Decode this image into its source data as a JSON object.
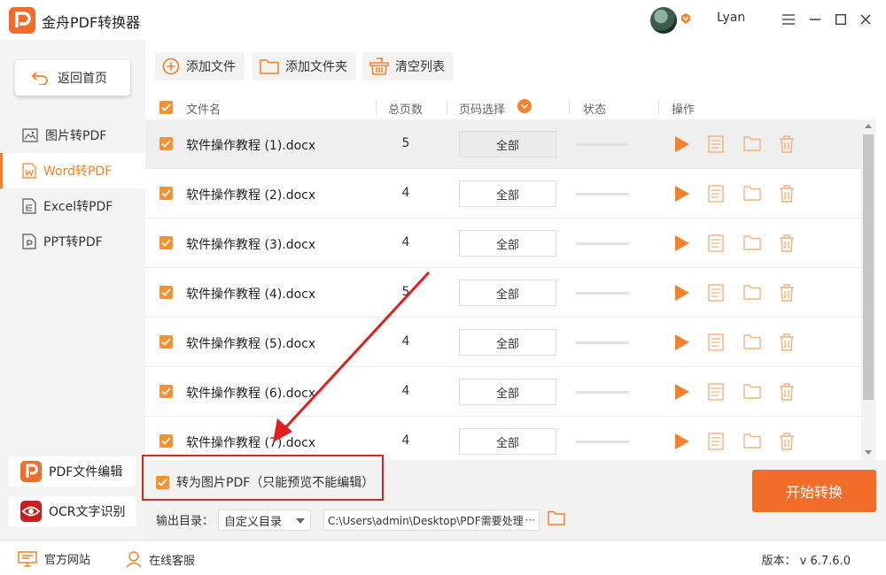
{
  "app": {
    "title": "金舟PDF转换器",
    "username": "Lyan"
  },
  "sidebar": {
    "back_label": "返回首页",
    "items": [
      {
        "label": "图片转PDF",
        "icon": "image-icon"
      },
      {
        "label": "Word转PDF",
        "icon": "word-icon",
        "active": true
      },
      {
        "label": "Excel转PDF",
        "icon": "excel-icon"
      },
      {
        "label": "PPT转PDF",
        "icon": "ppt-icon"
      }
    ],
    "tools": [
      {
        "label": "PDF文件编辑",
        "icon": "pdf-edit-icon"
      },
      {
        "label": "OCR文字识别",
        "icon": "ocr-eye-icon"
      }
    ]
  },
  "toolbar": {
    "add_file": "添加文件",
    "add_folder": "添加文件夹",
    "clear_list": "清空列表"
  },
  "table": {
    "headers": {
      "filename": "文件名",
      "pages": "总页数",
      "page_select": "页码选择",
      "status": "状态",
      "actions": "操作"
    },
    "rows": [
      {
        "name": "软件操作教程 (1).docx",
        "pages": "5",
        "range": "全部"
      },
      {
        "name": "软件操作教程 (2).docx",
        "pages": "4",
        "range": "全部"
      },
      {
        "name": "软件操作教程 (3).docx",
        "pages": "4",
        "range": "全部"
      },
      {
        "name": "软件操作教程 (4).docx",
        "pages": "5",
        "range": "全部"
      },
      {
        "name": "软件操作教程 (5).docx",
        "pages": "4",
        "range": "全部"
      },
      {
        "name": "软件操作教程 (6).docx",
        "pages": "4",
        "range": "全部"
      },
      {
        "name": "软件操作教程 (7).docx",
        "pages": "4",
        "range": "全部"
      }
    ]
  },
  "options": {
    "to_image_pdf": "转为图片PDF（只能预览不能编辑）",
    "output_label": "输出目录：",
    "output_mode": "自定义目录",
    "output_path": "C:\\Users\\admin\\Desktop\\PDF需要处理",
    "more": "···",
    "start_label": "开始转换"
  },
  "statusbar": {
    "website": "官方网站",
    "support": "在线客服",
    "version": "版本： v 6.7.6.0"
  },
  "colors": {
    "accent": "#f5812a",
    "start": "#f26d2a",
    "annotation": "#e02020"
  }
}
